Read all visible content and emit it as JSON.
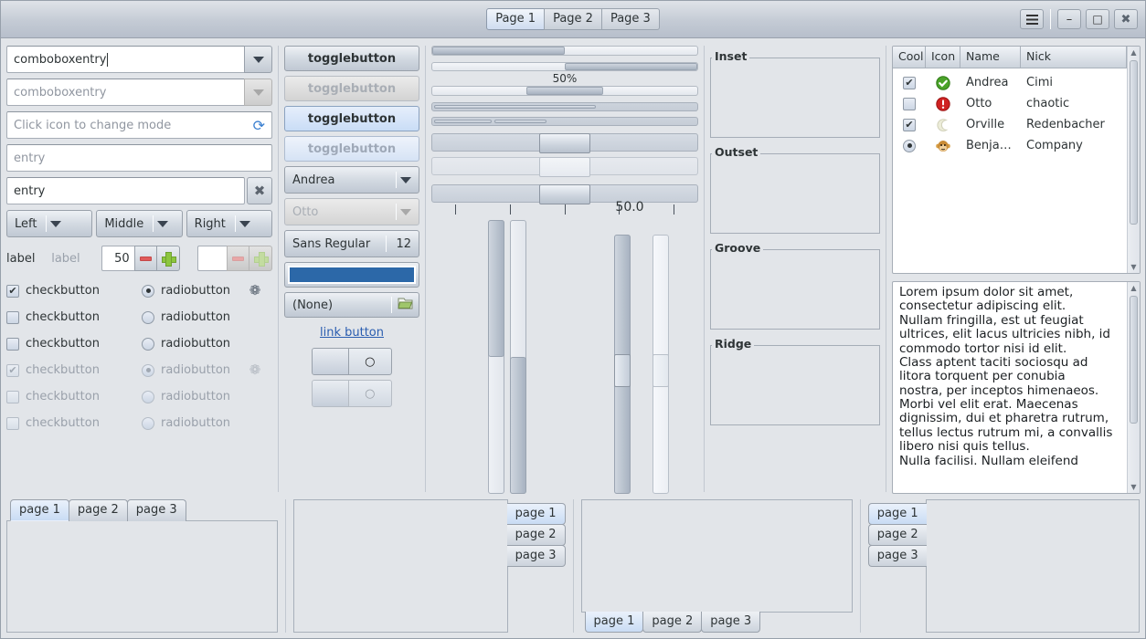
{
  "titlebar": {
    "pages": [
      {
        "label": "Page 1",
        "active": true
      },
      {
        "label": "Page 2",
        "active": false
      },
      {
        "label": "Page 3",
        "active": false
      }
    ],
    "menu_icon": "hamburger-menu-icon",
    "minimize_icon": "minimize-icon",
    "maximize_icon": "maximize-icon",
    "close_icon": "close-icon",
    "minimize_glyph": "–",
    "maximize_glyph": "□",
    "close_glyph": "✖"
  },
  "column1": {
    "comboboxentry_active": "comboboxentry",
    "comboboxentry_disabled": "comboboxentry",
    "icon_entry_placeholder": "Click icon to change mode",
    "icon_entry_icon": "refresh-icon",
    "icon_entry_glyph": "⟳",
    "entry_placeholder": "entry",
    "entry_value": "entry",
    "clear_icon": "clear-icon",
    "clear_glyph": "✖",
    "combos": [
      "Left",
      "Middle",
      "Right"
    ],
    "label_normal": "label",
    "label_disabled": "label",
    "spin_value": "50",
    "spin_value_blank": "",
    "minus_icon": "minus-icon",
    "plus_icon": "plus-icon",
    "checks": [
      {
        "label": "checkbutton",
        "checked": true,
        "disabled": false,
        "spinner": true
      },
      {
        "label": "checkbutton",
        "checked": false,
        "disabled": false,
        "spinner": false
      },
      {
        "label": "checkbutton",
        "checked": false,
        "disabled": false,
        "spinner": false
      },
      {
        "label": "checkbutton",
        "checked": true,
        "disabled": true,
        "spinner": true
      },
      {
        "label": "checkbutton",
        "checked": false,
        "disabled": true,
        "spinner": false
      },
      {
        "label": "checkbutton",
        "checked": false,
        "disabled": true,
        "spinner": false
      }
    ],
    "radios": [
      {
        "label": "radiobutton",
        "selected": true,
        "disabled": false
      },
      {
        "label": "radiobutton",
        "selected": false,
        "disabled": false
      },
      {
        "label": "radiobutton",
        "selected": false,
        "disabled": false
      },
      {
        "label": "radiobutton",
        "selected": true,
        "disabled": true
      },
      {
        "label": "radiobutton",
        "selected": false,
        "disabled": true
      },
      {
        "label": "radiobutton",
        "selected": false,
        "disabled": true
      }
    ],
    "spinner_glyph": "❁"
  },
  "column2": {
    "toggles": [
      {
        "label": "togglebutton",
        "active": false,
        "disabled": false
      },
      {
        "label": "togglebutton",
        "active": false,
        "disabled": true
      },
      {
        "label": "togglebutton",
        "active": true,
        "disabled": false
      },
      {
        "label": "togglebutton",
        "active": true,
        "disabled": true
      }
    ],
    "combo_enabled": "Andrea",
    "combo_disabled": "Otto",
    "font_name": "Sans Regular",
    "font_size": "12",
    "color_value": "#2c68a8",
    "file_label": "(None)",
    "file_icon": "folder-open-icon",
    "file_glyph": "📁",
    "link_label": "link button",
    "switches": [
      {
        "state": "off",
        "glyph": "○",
        "disabled": false
      },
      {
        "state": "off",
        "glyph": "○",
        "disabled": true
      }
    ]
  },
  "column3": {
    "progress_left": {
      "value": 50,
      "label": ""
    },
    "progress_right": {
      "value": 50,
      "label": ""
    },
    "progress_pct_label": "50%",
    "progress_pct": {
      "value": 50
    },
    "trough_single": {
      "value": 62
    },
    "trough_multi": {
      "segments": [
        30,
        26
      ]
    },
    "scales": [
      {
        "value": 50,
        "disabled": false
      },
      {
        "value": 50,
        "disabled": true
      },
      {
        "value": 50,
        "disabled": false,
        "marks": 5
      }
    ],
    "vertical_label": "50.0",
    "vscales": [
      {
        "kind": "filled-top",
        "value": 50
      },
      {
        "kind": "filled-bottom",
        "value": 50
      },
      {
        "kind": "knob",
        "value": 50,
        "disabled": false
      },
      {
        "kind": "knob",
        "value": 50,
        "disabled": true
      }
    ]
  },
  "column4": {
    "frames": [
      {
        "title": "Inset"
      },
      {
        "title": "Outset"
      },
      {
        "title": "Groove"
      },
      {
        "title": "Ridge"
      }
    ]
  },
  "column5": {
    "treeview": {
      "columns": [
        "Cool",
        "Icon",
        "Name",
        "Nick"
      ],
      "rows": [
        {
          "cool": "check-on",
          "icon": "ok-green-icon",
          "icon_glyph": "✔",
          "name": "Andrea",
          "nick": "Cimi"
        },
        {
          "cool": "check-off",
          "icon": "error-red-icon",
          "icon_glyph": "!",
          "name": "Otto",
          "nick": "chaotic"
        },
        {
          "cool": "check-on",
          "icon": "moon-icon",
          "icon_glyph": "☽",
          "name": "Orville",
          "nick": "Redenbacher"
        },
        {
          "cool": "radio-on",
          "icon": "monkey-face-icon",
          "icon_glyph": "🐵",
          "name": "Benja…",
          "nick": "Company"
        }
      ]
    },
    "textview": {
      "lines": [
        "Lorem ipsum dolor sit amet,",
        "consectetur adipiscing elit.",
        "Nullam fringilla, est ut feugiat",
        "ultrices, elit lacus ultricies nibh, id",
        "commodo tortor nisi id elit.",
        "Class aptent taciti sociosqu ad",
        "litora torquent per conubia",
        "nostra, per inceptos himenaeos.",
        "Morbi vel elit erat. Maecenas",
        "dignissim, dui et pharetra rutrum,",
        "tellus lectus rutrum mi, a convallis",
        "libero nisi quis tellus.",
        "Nulla facilisi. Nullam eleifend"
      ]
    },
    "scroll_up_glyph": "▲",
    "scroll_down_glyph": "▼"
  },
  "notebooks": [
    {
      "position": "top",
      "tabs": [
        "page 1",
        "page 2",
        "page 3"
      ],
      "active": 0
    },
    {
      "position": "right",
      "tabs": [
        "page 1",
        "page 2",
        "page 3"
      ],
      "active": 0
    },
    {
      "position": "bottom",
      "tabs": [
        "page 1",
        "page 2",
        "page 3"
      ],
      "active": 0
    },
    {
      "position": "left",
      "tabs": [
        "page 1",
        "page 2",
        "page 3"
      ],
      "active": 0
    }
  ],
  "colors": {
    "background": "#e2e5e9",
    "accent_blue": "#c9dcf4",
    "link": "#2a5db0",
    "color_button": "#2c68a8",
    "border": "#a6adb6"
  }
}
